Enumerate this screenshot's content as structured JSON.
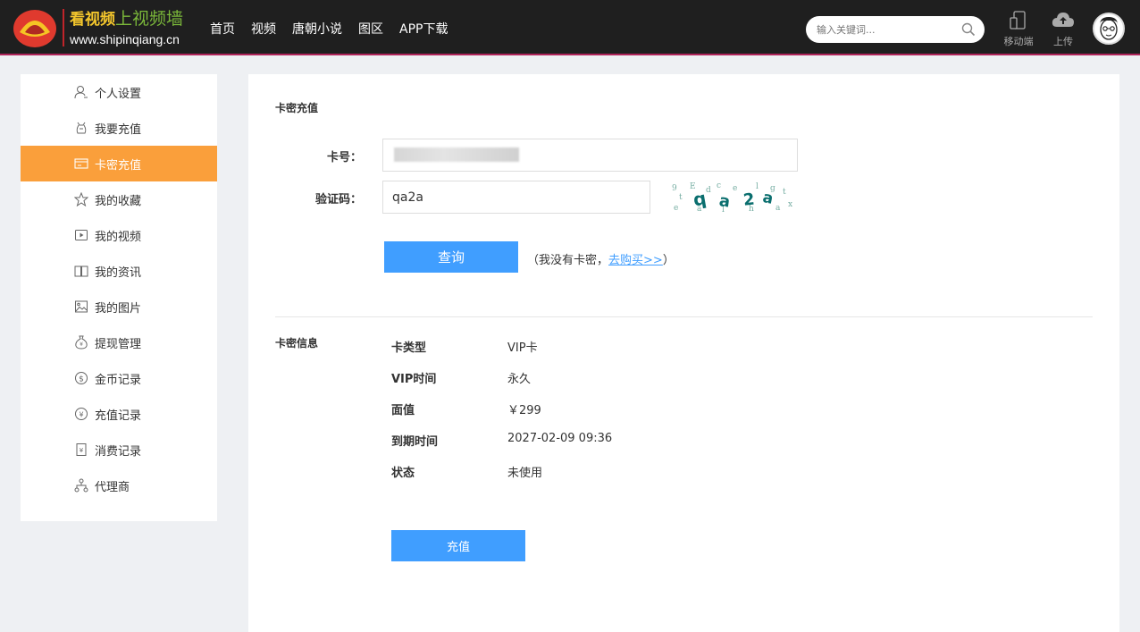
{
  "header": {
    "brand_title_part1": "看视频",
    "brand_title_part2": "上视频墙",
    "brand_url": "www.shipinqiang.cn",
    "nav": [
      "首页",
      "视频",
      "唐朝小说",
      "图区",
      "APP下载"
    ],
    "search_placeholder": "输入关键词...",
    "mobile_label": "移动端",
    "upload_label": "上传"
  },
  "sidebar": {
    "items": [
      {
        "label": "个人设置",
        "icon": "user-icon"
      },
      {
        "label": "我要充值",
        "icon": "wallet-icon"
      },
      {
        "label": "卡密充值",
        "icon": "card-icon",
        "active": true
      },
      {
        "label": "我的收藏",
        "icon": "star-icon"
      },
      {
        "label": "我的视频",
        "icon": "video-icon"
      },
      {
        "label": "我的资讯",
        "icon": "book-icon"
      },
      {
        "label": "我的图片",
        "icon": "image-icon"
      },
      {
        "label": "提现管理",
        "icon": "money-bag-icon"
      },
      {
        "label": "金币记录",
        "icon": "coin-icon"
      },
      {
        "label": "充值记录",
        "icon": "yuan-circle-icon"
      },
      {
        "label": "消费记录",
        "icon": "receipt-icon"
      },
      {
        "label": "代理商",
        "icon": "network-icon"
      }
    ]
  },
  "main": {
    "section_title": "卡密充值",
    "card_label": "卡号：",
    "card_value": "",
    "captcha_label": "验证码：",
    "captcha_value": "qa2a",
    "query_button": "查询",
    "note_prefix": "（我没有卡密，",
    "note_link": "去购买>>",
    "note_suffix": "）",
    "info_title": "卡密信息",
    "info": [
      {
        "key": "卡类型",
        "value": "VIP卡"
      },
      {
        "key": "VIP时间",
        "value": "永久"
      },
      {
        "key": "面值",
        "value": "￥299"
      },
      {
        "key": "到期时间",
        "value": "2027-02-09 09:36"
      },
      {
        "key": "状态",
        "value": "未使用"
      }
    ],
    "recharge_button": "充值"
  },
  "colors": {
    "header_bg": "#1f1f1f",
    "active_orange": "#fa9f3b",
    "button_blue": "#409eff",
    "page_bg": "#eef0f3"
  }
}
